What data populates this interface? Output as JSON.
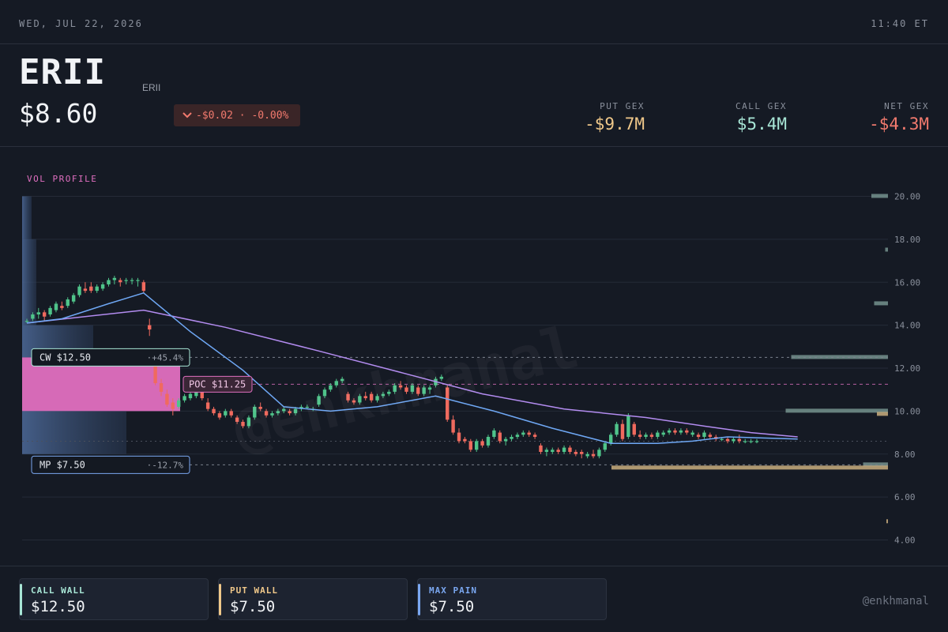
{
  "topbar": {
    "date": "WED, JUL 22, 2026",
    "time": "11:40 ET"
  },
  "header": {
    "ticker": "ERII",
    "sub_ticker": "ERII",
    "price": "$8.60",
    "change": "-$0.02 · -0.00%",
    "gex": [
      {
        "label": "PUT GEX",
        "value": "-$9.7M",
        "color": "#f0c88a"
      },
      {
        "label": "CALL GEX",
        "value": "$5.4M",
        "color": "#a8e6d6"
      },
      {
        "label": "NET GEX",
        "value": "-$4.3M",
        "color": "#f27a6e"
      }
    ]
  },
  "footer": {
    "cards": [
      {
        "label": "CALL WALL",
        "value": "$12.50",
        "color": "#a8e6d6"
      },
      {
        "label": "PUT WALL",
        "value": "$7.50",
        "color": "#f0c88a"
      },
      {
        "label": "MAX PAIN",
        "value": "$7.50",
        "color": "#7aa7f0"
      }
    ],
    "handle": "@enkhmanal"
  },
  "watermark": "@enkhmanal",
  "colors": {
    "up": "#4fc48a",
    "down": "#f06a5e",
    "poc": "#e06fc0",
    "mp": "#7aa7f0",
    "sma_fast": "#6fa8f5",
    "sma_slow": "#b38cf0"
  },
  "chart_data": {
    "type": "candlestick",
    "ylim": [
      3.5,
      20.5
    ],
    "y_ticks": [
      "20.00",
      "18.00",
      "16.00",
      "14.00",
      "12.00",
      "10.00",
      "8.00",
      "6.00",
      "4.00"
    ],
    "vol_profile_label": "VOL PROFILE",
    "levels": [
      {
        "name": "CW",
        "label": "CW $12.50",
        "price": 12.5,
        "pct": "+45.4%",
        "color": "#a8e6d6"
      },
      {
        "name": "POC",
        "label": "POC $11.25",
        "price": 11.25,
        "color": "#e06fc0"
      },
      {
        "name": "MP",
        "label": "MP $7.50",
        "price": 7.5,
        "pct": "-12.7%",
        "color": "#7aa7f0"
      },
      {
        "name": "LAST",
        "price": 8.6,
        "color": "#6a707c"
      }
    ],
    "vol_profile": [
      {
        "low": 18.0,
        "high": 20.0,
        "rel": 0.06
      },
      {
        "low": 14.0,
        "high": 18.0,
        "rel": 0.09
      },
      {
        "low": 12.5,
        "high": 14.0,
        "rel": 0.45
      },
      {
        "low": 10.0,
        "high": 12.5,
        "rel": 1.0,
        "poc": true
      },
      {
        "low": 8.0,
        "high": 10.0,
        "rel": 0.66
      },
      {
        "low": 7.5,
        "high": 8.0,
        "rel": 0.0
      }
    ],
    "gex_bars": [
      {
        "strike": 20.0,
        "value": 0.06,
        "side": "call"
      },
      {
        "strike": 17.5,
        "value": 0.01,
        "side": "call"
      },
      {
        "strike": 15.0,
        "value": 0.05,
        "side": "call"
      },
      {
        "strike": 12.5,
        "value": 0.35,
        "side": "call"
      },
      {
        "strike": 10.0,
        "value": 0.37,
        "side": "call"
      },
      {
        "strike": 10.0,
        "value": -0.04,
        "side": "put"
      },
      {
        "strike": 7.5,
        "value": 0.09,
        "side": "call"
      },
      {
        "strike": 7.5,
        "value": -1.0,
        "side": "put"
      },
      {
        "strike": 5.0,
        "value": -0.005,
        "side": "put"
      }
    ],
    "candles": [
      [
        14.2,
        14.3,
        14.1,
        14.2
      ],
      [
        14.3,
        14.6,
        14.2,
        14.5
      ],
      [
        14.5,
        14.8,
        14.3,
        14.6
      ],
      [
        14.6,
        14.7,
        14.2,
        14.4
      ],
      [
        14.5,
        14.9,
        14.4,
        14.8
      ],
      [
        14.7,
        15.1,
        14.6,
        15.0
      ],
      [
        14.9,
        15.1,
        14.7,
        14.8
      ],
      [
        14.9,
        15.3,
        14.8,
        15.2
      ],
      [
        15.1,
        15.5,
        15.0,
        15.4
      ],
      [
        15.4,
        15.9,
        15.3,
        15.8
      ],
      [
        15.7,
        16.0,
        15.5,
        15.6
      ],
      [
        15.8,
        16.0,
        15.5,
        15.6
      ],
      [
        15.6,
        15.9,
        15.5,
        15.8
      ],
      [
        15.7,
        16.0,
        15.6,
        15.9
      ],
      [
        15.9,
        16.2,
        15.8,
        16.1
      ],
      [
        16.1,
        16.3,
        15.9,
        16.2
      ],
      [
        16.1,
        16.2,
        15.8,
        16.0
      ],
      [
        16.1,
        16.2,
        15.9,
        16.1
      ],
      [
        16.1,
        16.2,
        15.9,
        16.1
      ],
      [
        16.1,
        16.2,
        15.8,
        16.1
      ],
      [
        16.0,
        16.1,
        15.5,
        15.6
      ],
      [
        14.0,
        14.3,
        13.5,
        13.8
      ],
      [
        12.6,
        12.9,
        11.2,
        11.3
      ],
      [
        11.3,
        11.5,
        10.7,
        10.9
      ],
      [
        10.8,
        11.0,
        10.2,
        10.3
      ],
      [
        10.4,
        10.6,
        9.8,
        10.1
      ],
      [
        10.2,
        10.6,
        10.1,
        10.5
      ],
      [
        10.5,
        10.8,
        10.4,
        10.7
      ],
      [
        10.6,
        10.9,
        10.5,
        10.8
      ],
      [
        10.7,
        11.0,
        10.6,
        10.9
      ],
      [
        10.9,
        11.0,
        10.5,
        10.6
      ],
      [
        10.4,
        10.6,
        10.0,
        10.1
      ],
      [
        10.1,
        10.2,
        9.8,
        9.9
      ],
      [
        9.9,
        10.0,
        9.6,
        9.7
      ],
      [
        9.8,
        10.1,
        9.7,
        10.0
      ],
      [
        10.0,
        10.1,
        9.7,
        9.8
      ],
      [
        9.7,
        9.8,
        9.4,
        9.5
      ],
      [
        9.5,
        9.6,
        9.2,
        9.3
      ],
      [
        9.3,
        9.8,
        9.2,
        9.7
      ],
      [
        9.7,
        10.3,
        9.6,
        10.2
      ],
      [
        10.2,
        10.4,
        10.0,
        10.1
      ],
      [
        10.0,
        10.1,
        9.7,
        9.8
      ],
      [
        9.8,
        10.0,
        9.7,
        9.9
      ],
      [
        9.9,
        10.1,
        9.8,
        10.0
      ],
      [
        10.0,
        10.2,
        9.9,
        10.1
      ],
      [
        10.0,
        10.1,
        9.8,
        9.9
      ],
      [
        9.9,
        10.2,
        9.8,
        10.1
      ],
      [
        10.1,
        10.3,
        10.0,
        10.2
      ],
      [
        10.2,
        10.3,
        10.1,
        10.2
      ],
      [
        10.1,
        10.2,
        10.0,
        10.1
      ],
      [
        10.3,
        10.8,
        10.2,
        10.7
      ],
      [
        10.7,
        11.1,
        10.6,
        11.0
      ],
      [
        11.0,
        11.3,
        10.9,
        11.2
      ],
      [
        11.2,
        11.5,
        11.1,
        11.4
      ],
      [
        11.4,
        11.6,
        11.3,
        11.5
      ],
      [
        10.8,
        10.9,
        10.4,
        10.5
      ],
      [
        10.5,
        10.6,
        10.3,
        10.4
      ],
      [
        10.4,
        10.8,
        10.3,
        10.7
      ],
      [
        10.7,
        10.9,
        10.5,
        10.6
      ],
      [
        10.8,
        10.9,
        10.4,
        10.5
      ],
      [
        10.5,
        10.8,
        10.4,
        10.7
      ],
      [
        10.7,
        10.9,
        10.6,
        10.8
      ],
      [
        10.8,
        11.0,
        10.7,
        10.9
      ],
      [
        10.9,
        11.3,
        10.8,
        11.2
      ],
      [
        11.2,
        11.4,
        11.0,
        11.1
      ],
      [
        11.1,
        11.2,
        10.8,
        10.9
      ],
      [
        10.9,
        11.3,
        10.8,
        11.2
      ],
      [
        11.1,
        11.2,
        10.7,
        10.8
      ],
      [
        10.8,
        11.2,
        10.7,
        11.1
      ],
      [
        11.0,
        11.2,
        10.8,
        11.1
      ],
      [
        11.2,
        11.6,
        11.1,
        11.5
      ],
      [
        11.5,
        11.7,
        11.4,
        11.6
      ],
      [
        11.1,
        11.2,
        9.5,
        9.6
      ],
      [
        9.6,
        9.8,
        8.9,
        9.0
      ],
      [
        9.0,
        9.2,
        8.5,
        8.6
      ],
      [
        8.7,
        8.8,
        8.5,
        8.6
      ],
      [
        8.6,
        8.7,
        8.1,
        8.2
      ],
      [
        8.2,
        8.7,
        8.1,
        8.6
      ],
      [
        8.6,
        8.7,
        8.3,
        8.4
      ],
      [
        8.4,
        8.9,
        8.3,
        8.8
      ],
      [
        8.8,
        9.2,
        8.7,
        9.1
      ],
      [
        9.0,
        9.1,
        8.5,
        8.6
      ],
      [
        8.6,
        8.8,
        8.4,
        8.7
      ],
      [
        8.7,
        8.9,
        8.6,
        8.8
      ],
      [
        8.8,
        9.0,
        8.7,
        8.9
      ],
      [
        8.9,
        9.1,
        8.8,
        9.0
      ],
      [
        9.0,
        9.1,
        8.8,
        8.9
      ],
      [
        8.9,
        9.0,
        8.7,
        8.8
      ],
      [
        8.4,
        8.5,
        8.0,
        8.1
      ],
      [
        8.1,
        8.3,
        7.9,
        8.2
      ],
      [
        8.1,
        8.3,
        8.0,
        8.2
      ],
      [
        8.2,
        8.3,
        8.0,
        8.1
      ],
      [
        8.1,
        8.4,
        8.0,
        8.3
      ],
      [
        8.3,
        8.4,
        8.0,
        8.1
      ],
      [
        8.1,
        8.2,
        7.9,
        8.0
      ],
      [
        8.1,
        8.2,
        7.8,
        8.0
      ],
      [
        7.9,
        8.1,
        7.8,
        8.0
      ],
      [
        8.0,
        8.2,
        7.8,
        7.9
      ],
      [
        7.9,
        8.3,
        7.8,
        8.2
      ],
      [
        8.2,
        8.6,
        8.1,
        8.5
      ],
      [
        8.5,
        9.0,
        8.4,
        8.9
      ],
      [
        8.9,
        9.5,
        8.8,
        9.4
      ],
      [
        9.4,
        9.6,
        8.6,
        8.7
      ],
      [
        8.8,
        9.9,
        8.7,
        9.8
      ],
      [
        9.4,
        9.5,
        8.8,
        8.9
      ],
      [
        8.9,
        9.1,
        8.7,
        8.8
      ],
      [
        8.8,
        9.0,
        8.7,
        8.9
      ],
      [
        8.9,
        9.0,
        8.7,
        8.8
      ],
      [
        8.8,
        9.1,
        8.7,
        9.0
      ],
      [
        8.9,
        9.1,
        8.8,
        9.0
      ],
      [
        9.0,
        9.2,
        8.9,
        9.1
      ],
      [
        9.1,
        9.2,
        8.9,
        9.0
      ],
      [
        9.0,
        9.2,
        8.9,
        9.1
      ],
      [
        9.1,
        9.2,
        8.9,
        9.0
      ],
      [
        8.9,
        9.1,
        8.8,
        9.0
      ],
      [
        8.9,
        9.0,
        8.7,
        8.8
      ],
      [
        8.8,
        9.1,
        8.7,
        9.0
      ],
      [
        8.9,
        9.0,
        8.7,
        8.8
      ],
      [
        8.8,
        8.9,
        8.6,
        8.7
      ],
      [
        8.7,
        8.8,
        8.6,
        8.7
      ],
      [
        8.7,
        8.8,
        8.5,
        8.6
      ],
      [
        8.6,
        8.8,
        8.5,
        8.7
      ],
      [
        8.7,
        8.9,
        8.5,
        8.6
      ],
      [
        8.6,
        8.7,
        8.5,
        8.6
      ],
      [
        8.6,
        8.7,
        8.5,
        8.6
      ],
      [
        8.6,
        8.7,
        8.5,
        8.6
      ]
    ],
    "sma_fast": [
      [
        0,
        14.1
      ],
      [
        6,
        14.3
      ],
      [
        14,
        15.0
      ],
      [
        20,
        15.5
      ],
      [
        28,
        13.7
      ],
      [
        37,
        11.9
      ],
      [
        44,
        10.2
      ],
      [
        52,
        10.0
      ],
      [
        60,
        10.2
      ],
      [
        70,
        10.7
      ],
      [
        80,
        10.0
      ],
      [
        90,
        9.2
      ],
      [
        100,
        8.5
      ],
      [
        108,
        8.5
      ],
      [
        114,
        8.6
      ],
      [
        120,
        8.8
      ],
      [
        132,
        8.7
      ]
    ],
    "sma_slow": [
      [
        0,
        14.1
      ],
      [
        20,
        14.7
      ],
      [
        34,
        13.9
      ],
      [
        50,
        12.8
      ],
      [
        64,
        11.8
      ],
      [
        78,
        10.8
      ],
      [
        92,
        10.1
      ],
      [
        106,
        9.7
      ],
      [
        116,
        9.3
      ],
      [
        124,
        9.0
      ],
      [
        132,
        8.8
      ]
    ]
  }
}
